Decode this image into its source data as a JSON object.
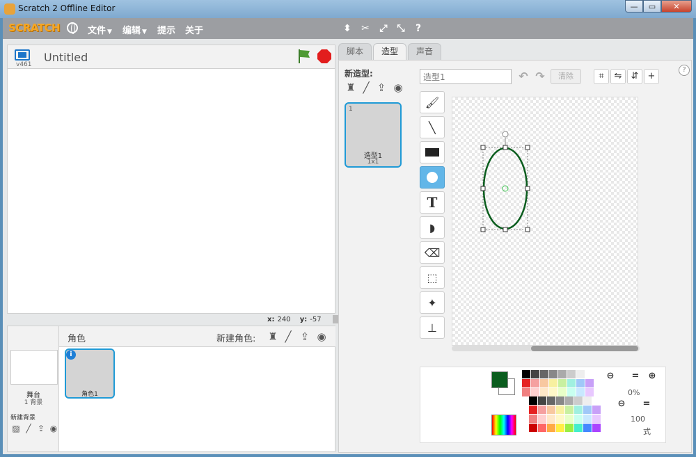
{
  "window": {
    "title": "Scratch 2 Offline Editor"
  },
  "menu": {
    "logo": "SCRATCH",
    "file": "文件",
    "edit": "编辑",
    "tips": "提示",
    "about": "关于"
  },
  "stage": {
    "version": "v461",
    "project_title": "Untitled",
    "coords": {
      "x_label": "x:",
      "x_value": "240",
      "y_label": "y:",
      "y_value": "-57"
    }
  },
  "sprites": {
    "title": "角色",
    "new_sprite_label": "新建角色:",
    "stage_label": "舞台",
    "stage_count": "1 背景",
    "new_backdrop_label": "新建背景",
    "items": [
      {
        "name": "角色1",
        "info": "i"
      }
    ]
  },
  "tabs": [
    {
      "label": "脚本"
    },
    {
      "label": "造型"
    },
    {
      "label": "声音"
    }
  ],
  "costumes": {
    "new_costume_label": "新造型:",
    "items": [
      {
        "number": "1",
        "name": "造型1",
        "size": "1x1"
      }
    ]
  },
  "editor": {
    "costume_name": "造型1",
    "clear_label": "清除",
    "zoom_1": "0%",
    "zoom_2": "100",
    "extra_label": "式",
    "colors": {
      "primary": "#0b5d1e",
      "secondary": "#ffffff",
      "ellipse_stroke": "#0b5d1e",
      "selection_handle": "#333333",
      "center_mark": "#36c24a"
    },
    "tools": [
      {
        "name": "brush-icon"
      },
      {
        "name": "line-icon"
      },
      {
        "name": "rectangle-icon"
      },
      {
        "name": "ellipse-icon",
        "active": true
      },
      {
        "name": "text-icon",
        "glyph": "T"
      },
      {
        "name": "fill-icon"
      },
      {
        "name": "eraser-icon"
      },
      {
        "name": "select-icon"
      },
      {
        "name": "magic-select-icon"
      },
      {
        "name": "stamp-icon"
      }
    ]
  },
  "palette": {
    "row1": [
      "#000000",
      "#444444",
      "#666666",
      "#888888",
      "#aaaaaa",
      "#cccccc",
      "#eeeeee",
      "#ffffff"
    ],
    "row2": [
      "#e52222",
      "#f5a0a0",
      "#f8c8a0",
      "#f8f0a0",
      "#c8f0a0",
      "#a0f0e0",
      "#a0c8f8",
      "#c8a0f8"
    ],
    "row3": [
      "#f08080",
      "#ffd0d0",
      "#ffe8c8",
      "#fff8c8",
      "#e8ffc8",
      "#c8fff0",
      "#c8e8ff",
      "#e8c8ff"
    ]
  },
  "palette2": {
    "row1": [
      "#000000",
      "#444444",
      "#666666",
      "#888888",
      "#aaaaaa",
      "#cccccc",
      "#eeeeee",
      "#ffffff"
    ],
    "row2": [
      "#e52222",
      "#f5a0a0",
      "#f8c8a0",
      "#f8f0a0",
      "#c8f0a0",
      "#a0f0e0",
      "#a0c8f8",
      "#c8a0f8"
    ],
    "row3": [
      "#f08080",
      "#ffd0d0",
      "#ffe8c8",
      "#fff8c8",
      "#e8ffc8",
      "#c8fff0",
      "#c8e8ff",
      "#e8c8ff"
    ],
    "row4": [
      "#cc0000",
      "#ff6666",
      "#ffaa44",
      "#ffee44",
      "#99ee44",
      "#44eecc",
      "#4488ff",
      "#aa44ff"
    ]
  }
}
